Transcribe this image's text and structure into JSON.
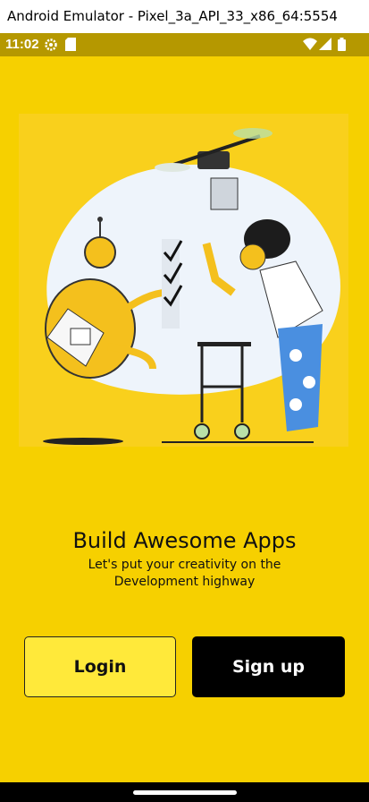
{
  "window": {
    "title": "Android Emulator - Pixel_3a_API_33_x86_64:5554"
  },
  "status_bar": {
    "time": "11:02"
  },
  "welcome": {
    "headline": "Build Awesome Apps",
    "subtitle": "Let's put your creativity on the Development highway"
  },
  "buttons": {
    "login": "Login",
    "signup": "Sign up"
  },
  "colors": {
    "background": "#f6d000",
    "login_button": "#ffe93a",
    "signup_button": "#000000"
  },
  "icons": [
    "settings-icon",
    "sd-card-icon",
    "wifi-icon",
    "signal-icon",
    "battery-icon"
  ]
}
